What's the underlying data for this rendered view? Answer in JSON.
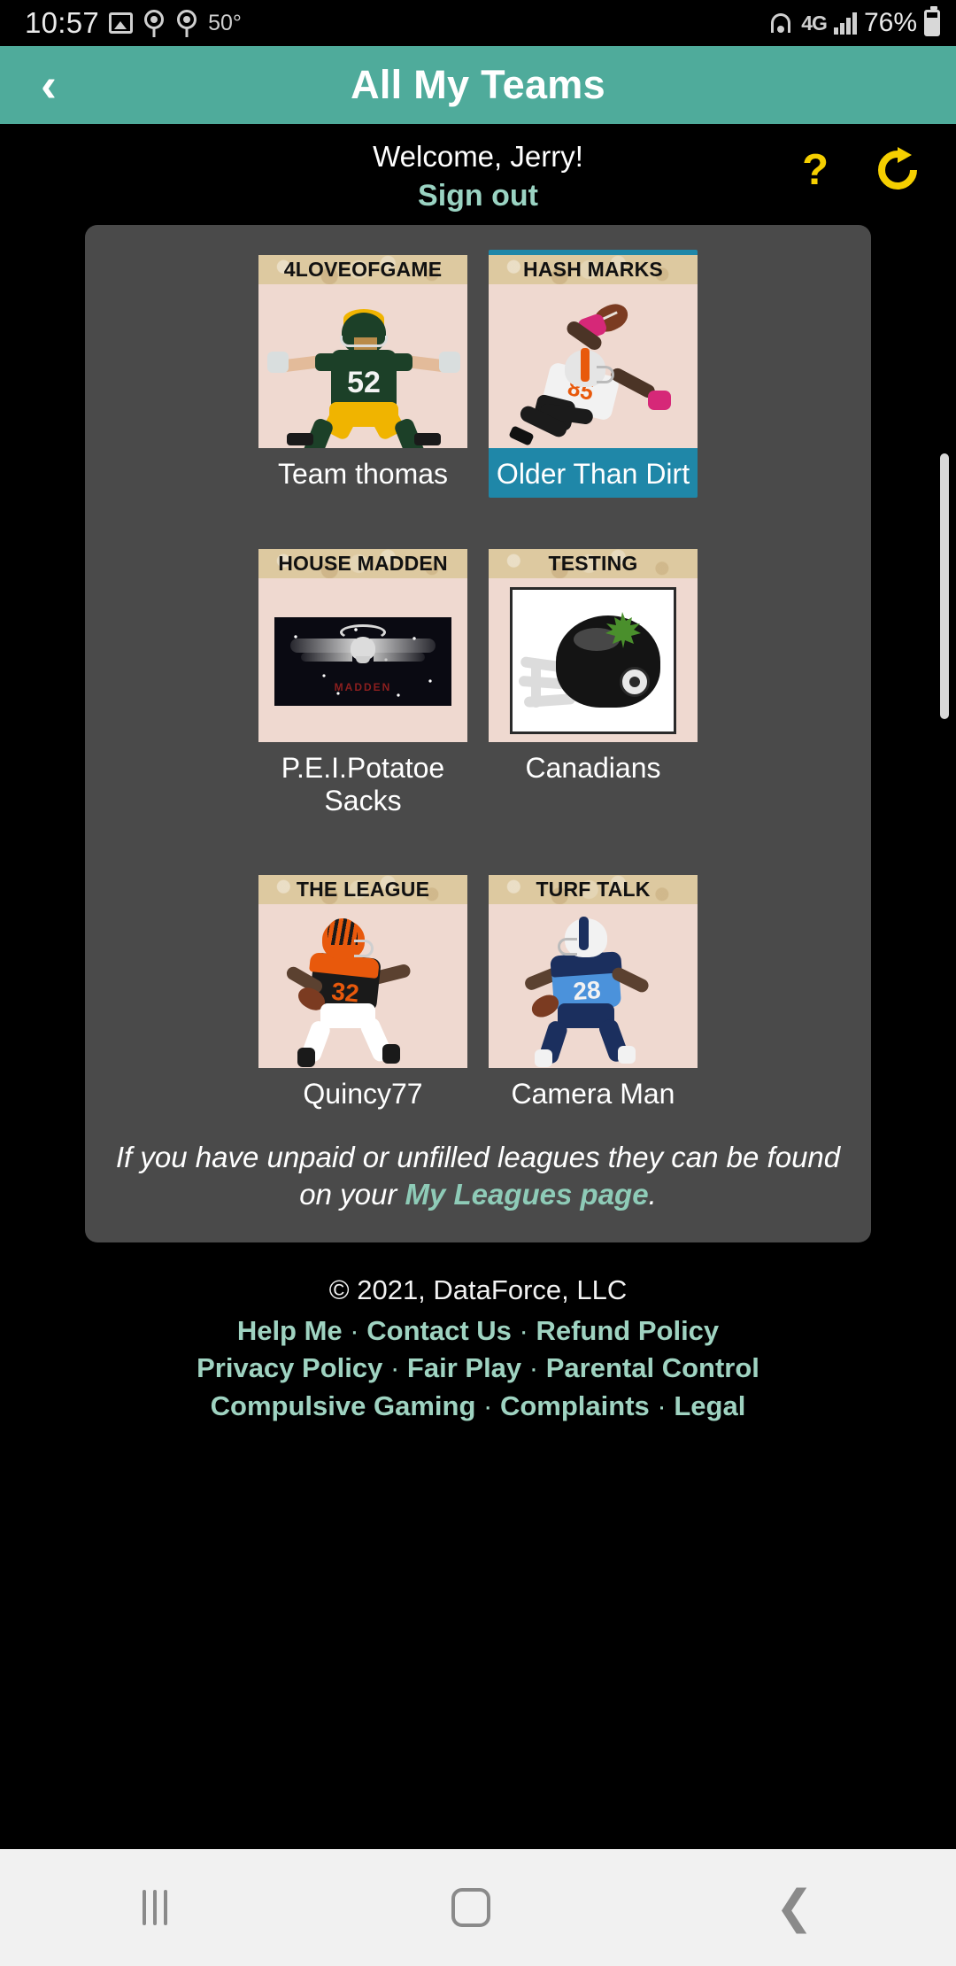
{
  "status_bar": {
    "time": "10:57",
    "temperature": "50°",
    "network": "4G",
    "battery_percent": "76%",
    "icons": [
      "image-icon",
      "cast-icon",
      "cast-icon",
      "wifi-icon",
      "signal-bars-icon",
      "battery-icon"
    ]
  },
  "app_bar": {
    "back_label": "‹",
    "title": "All My Teams"
  },
  "welcome": {
    "greeting": "Welcome, Jerry!",
    "sign_out": "Sign out",
    "help_icon": "?",
    "refresh_icon": "refresh-icon"
  },
  "teams": [
    {
      "league": "4LOVEOFGAME",
      "name": "Team thomas",
      "selected": false
    },
    {
      "league": "HASH MARKS",
      "name": "Older Than Dirt",
      "selected": true
    },
    {
      "league": "HOUSE MADDEN",
      "name": "P.E.I.Potatoe Sacks",
      "selected": false
    },
    {
      "league": "TESTING",
      "name": "Canadians",
      "selected": false
    },
    {
      "league": "THE LEAGUE",
      "name": "Quincy77",
      "selected": false
    },
    {
      "league": "TURF TALK",
      "name": "Camera Man",
      "selected": false
    }
  ],
  "note": {
    "before": "If you have unpaid or unfilled leagues they can be found on your ",
    "link": "My Leagues page",
    "after": "."
  },
  "footer": {
    "copyright": "© 2021, DataForce, LLC",
    "links_row1": [
      "Help Me",
      "Contact Us",
      "Refund Policy"
    ],
    "links_row2": [
      "Privacy Policy",
      "Fair Play",
      "Parental Control"
    ],
    "links_row3": [
      "Compulsive Gaming",
      "Complaints",
      "Legal"
    ],
    "separator": "·"
  },
  "nav_bar": {
    "recents": "recents-icon",
    "home": "home-icon",
    "back": "back-icon"
  },
  "colors": {
    "appbar": "#4fab9b",
    "accent_link": "#9fd3c1",
    "selected_card": "#1f87a8",
    "panel": "#4a4a4a",
    "icon_yellow": "#f5cf00",
    "card_header": "#ddc9a0",
    "card_photo_bg": "#efd9d0"
  }
}
